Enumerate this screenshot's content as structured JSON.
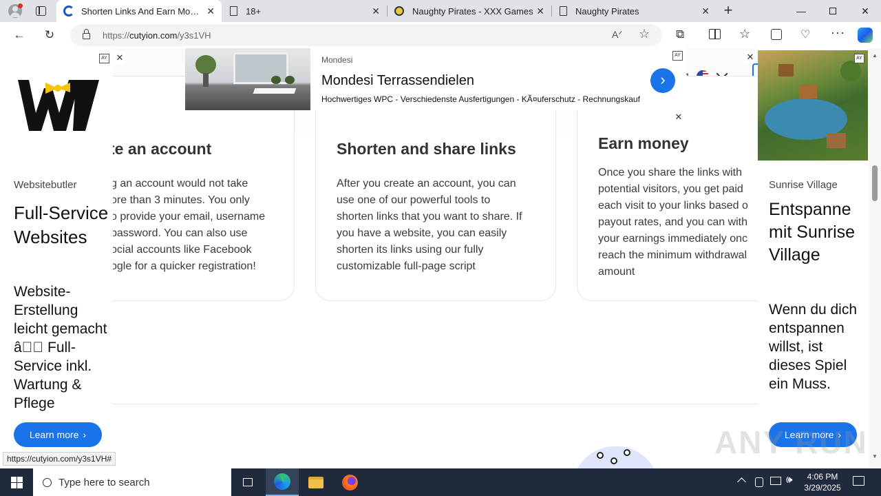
{
  "tabs": [
    {
      "title": "Shorten Links And Earn Money | ",
      "active": true
    },
    {
      "title": "18+",
      "active": false
    },
    {
      "title": "Naughty Pirates - XXX Games",
      "active": false
    },
    {
      "title": "Naughty Pirates",
      "active": false
    }
  ],
  "address": {
    "scheme": "https://",
    "host": "cutyion.com",
    "path": "/y3s1VH"
  },
  "header": {
    "partial_count": "1"
  },
  "cards": [
    {
      "title": "te an account",
      "text_lines": [
        "g an account would not take",
        "ore than 3 minutes. You only",
        "o provide your email, username",
        "password. You can also use",
        "ocial accounts like Facebook",
        "ogle for a quicker registration!"
      ]
    },
    {
      "title": "Shorten and share links",
      "text_lines": [
        "After you create an account, you can",
        "use one of our powerful tools to",
        "shorten links that you want to share. If",
        "you have a website, you can easily",
        "shorten its links using our fully",
        "customizable full-page script"
      ]
    },
    {
      "title": "Earn money",
      "text_lines": [
        "Once you share the links with",
        "potential visitors, you get paid",
        "each visit to your links based o",
        "payout rates, and you can with",
        "your earnings immediately onc",
        "reach the minimum withdrawal",
        "amount"
      ]
    }
  ],
  "ad_left": {
    "brand": "Websitebutler",
    "headline": "Full-Service Websites",
    "body": "Website-Erstellung leicht gemacht â\u0000\u0000 Full-Service inkl. Wartung & Pflege",
    "cta": "Learn more"
  },
  "ad_top": {
    "brand": "Mondesi",
    "title": "Mondesi Terrassendielen",
    "description": "Hochwertiges WPC - Verschiedenste Ausfertigungen - KÃ¤uferschutz - Rechnungskauf"
  },
  "ad_right": {
    "brand": "Sunrise Village",
    "headline": "Entspanne mit Sunrise Village",
    "body": "Wenn du dich entspannen willst, ist dieses Spiel ein Muss.",
    "cta": "Learn more"
  },
  "status_bar_url": "https://cutyion.com/y3s1VH#",
  "taskbar": {
    "search_placeholder": "Type here to search",
    "time": "4:06 PM",
    "date": "3/29/2025"
  },
  "watermark": "ANY RUN",
  "colors": {
    "accent_blue": "#1a73e8",
    "taskbar": "#1f2b3c",
    "tabbar": "#dfe3e8"
  }
}
